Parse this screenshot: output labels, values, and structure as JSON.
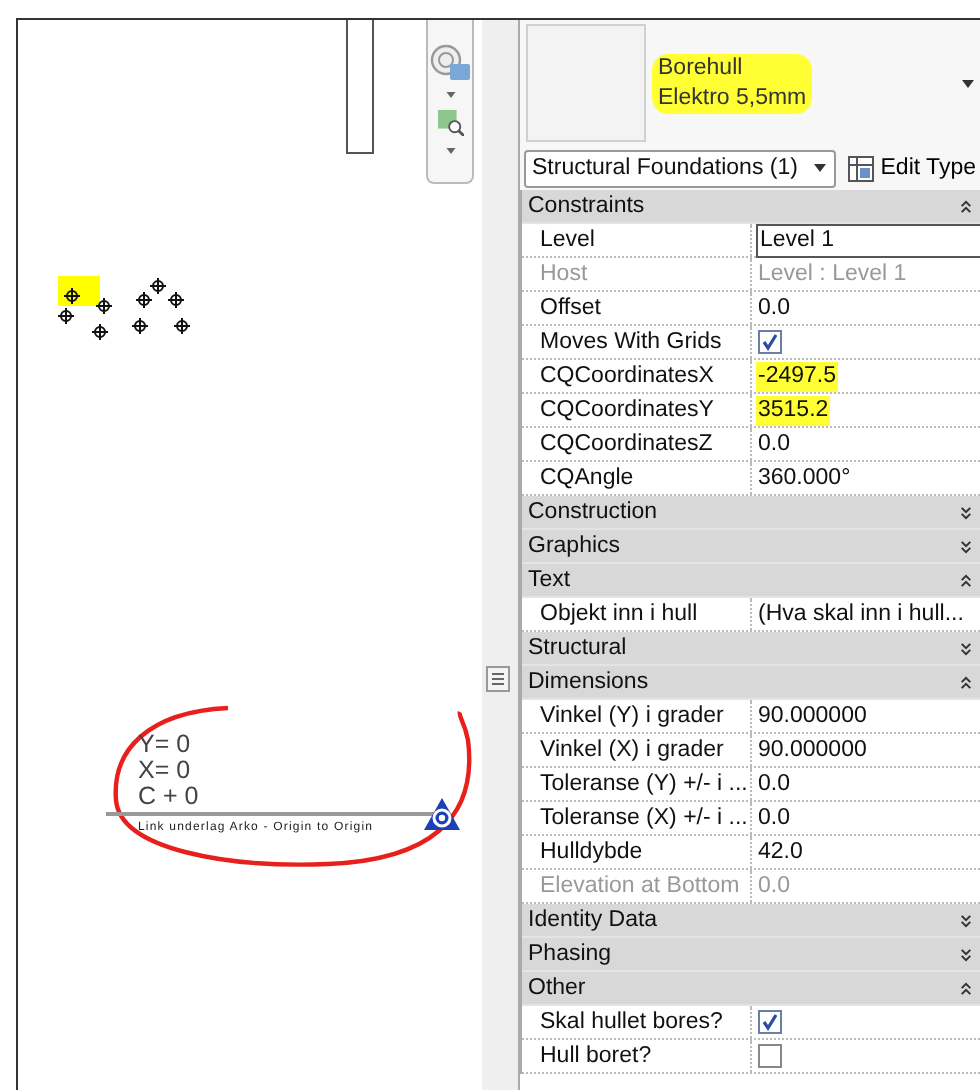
{
  "annotation": {
    "lines": [
      "Y= 0",
      "X= 0",
      "C + 0"
    ],
    "caption": "Link underlag Arko - Origin to Origin"
  },
  "properties": {
    "type_name": {
      "lines": [
        "Borehull",
        "Elektro 5,5mm"
      ],
      "highlighted": true
    },
    "selector": "Structural Foundations (1)",
    "edit_type": "Edit Type",
    "groups": [
      {
        "name": "Constraints",
        "expanded": true,
        "rows": [
          {
            "kind": "text",
            "label": "Level",
            "value": "Level 1",
            "disabled": false,
            "editing": true,
            "highlighted": false
          },
          {
            "kind": "text",
            "label": "Host",
            "value": "Level : Level 1",
            "disabled": true,
            "editing": false,
            "highlighted": false
          },
          {
            "kind": "text",
            "label": "Offset",
            "value": "0.0",
            "disabled": false,
            "editing": false,
            "highlighted": false
          },
          {
            "kind": "checkbox",
            "label": "Moves With Grids",
            "checked": true,
            "disabled": false
          },
          {
            "kind": "text",
            "label": "CQCoordinatesX",
            "value": "-2497.5",
            "disabled": false,
            "editing": false,
            "highlighted": true
          },
          {
            "kind": "text",
            "label": "CQCoordinatesY",
            "value": "3515.2",
            "disabled": false,
            "editing": false,
            "highlighted": true
          },
          {
            "kind": "text",
            "label": "CQCoordinatesZ",
            "value": "0.0",
            "disabled": false,
            "editing": false,
            "highlighted": false
          },
          {
            "kind": "text",
            "label": "CQAngle",
            "value": "360.000°",
            "disabled": false,
            "editing": false,
            "highlighted": false
          }
        ]
      },
      {
        "name": "Construction",
        "expanded": false
      },
      {
        "name": "Graphics",
        "expanded": false
      },
      {
        "name": "Text",
        "expanded": true,
        "rows": [
          {
            "kind": "text",
            "label": "Objekt inn i hull",
            "value": "(Hva skal inn i hull...",
            "disabled": false,
            "editing": false,
            "highlighted": false
          }
        ]
      },
      {
        "name": "Structural",
        "expanded": false
      },
      {
        "name": "Dimensions",
        "expanded": true,
        "rows": [
          {
            "kind": "text",
            "label": "Vinkel (Y) i grader",
            "value": "90.000000",
            "disabled": false,
            "editing": false,
            "highlighted": false
          },
          {
            "kind": "text",
            "label": "Vinkel (X) i grader",
            "value": "90.000000",
            "disabled": false,
            "editing": false,
            "highlighted": false
          },
          {
            "kind": "text",
            "label": "Toleranse (Y) +/- i ...",
            "value": "0.0",
            "disabled": false,
            "editing": false,
            "highlighted": false
          },
          {
            "kind": "text",
            "label": "Toleranse (X) +/- i ...",
            "value": "0.0",
            "disabled": false,
            "editing": false,
            "highlighted": false
          },
          {
            "kind": "text",
            "label": "Hulldybde",
            "value": "42.0",
            "disabled": false,
            "editing": false,
            "highlighted": false
          },
          {
            "kind": "text",
            "label": "Elevation at Bottom",
            "value": "0.0",
            "disabled": true,
            "editing": false,
            "highlighted": false
          }
        ]
      },
      {
        "name": "Identity Data",
        "expanded": false
      },
      {
        "name": "Phasing",
        "expanded": false
      },
      {
        "name": "Other",
        "expanded": true,
        "rows": [
          {
            "kind": "checkbox",
            "label": "Skal hullet bores?",
            "checked": true,
            "disabled": false
          },
          {
            "kind": "checkbox",
            "label": "Hull boret?",
            "checked": false,
            "disabled": false
          }
        ]
      }
    ]
  }
}
